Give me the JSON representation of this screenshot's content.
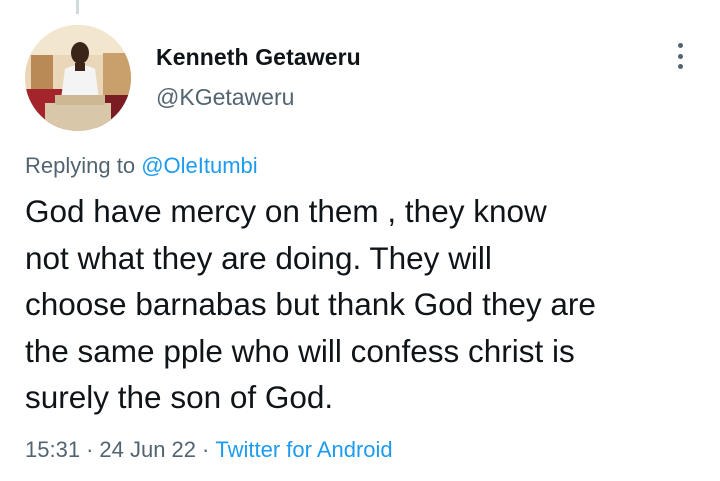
{
  "tweet": {
    "author": {
      "name": "Kenneth Getaweru",
      "handle": "@KGetaweru"
    },
    "replying": {
      "prefix": "Replying to ",
      "to": "@OleItumbi"
    },
    "text_lines": [
      "God have mercy on them , they know",
      "not what they are doing. They will",
      "choose barnabas but thank God they are",
      "the same pple who will confess christ is",
      "surely the son of God."
    ],
    "meta": {
      "time": "15:31",
      "separator": "·",
      "date": "24 Jun 22",
      "source": "Twitter for Android"
    }
  },
  "icons": {
    "more": "more-vertical-icon"
  },
  "colors": {
    "text": "#0f1419",
    "secondary": "#536471",
    "accent": "#1d9bf0"
  }
}
